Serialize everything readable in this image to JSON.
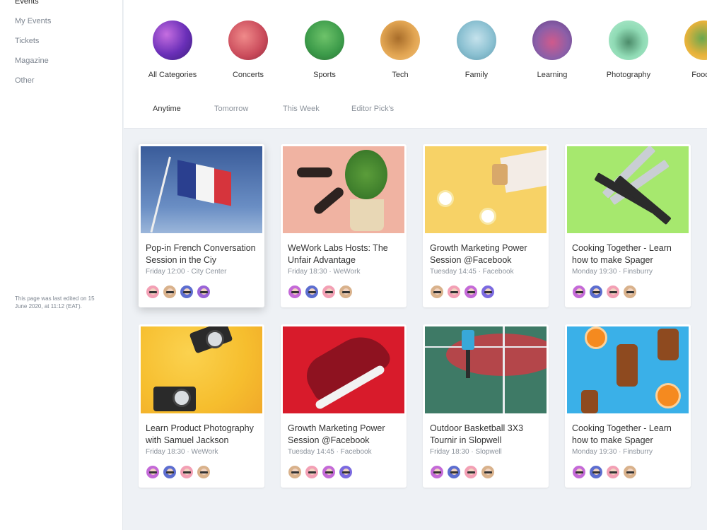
{
  "sidebar": {
    "items": [
      {
        "label": "Events"
      },
      {
        "label": "My Events"
      },
      {
        "label": "Tickets"
      },
      {
        "label": "Magazine"
      },
      {
        "label": "Other"
      }
    ],
    "edit_note": "This page was last edited on 15 June 2020, at 11:12 (EAT)."
  },
  "categories": [
    {
      "label": "All Categories",
      "color": "#7b3fc4"
    },
    {
      "label": "Concerts",
      "color": "#d9596b"
    },
    {
      "label": "Sports",
      "color": "#3f9b4d"
    },
    {
      "label": "Tech",
      "color": "#e2a552"
    },
    {
      "label": "Family",
      "color": "#8cc1d2"
    },
    {
      "label": "Learning",
      "color": "#8b5fa8"
    },
    {
      "label": "Photography",
      "color": "#90dbb5"
    },
    {
      "label": "Food &",
      "color": "#e8b23a"
    }
  ],
  "tabs": [
    {
      "label": "Anytime",
      "active": true
    },
    {
      "label": "Tomorrow"
    },
    {
      "label": "This Week"
    },
    {
      "label": "Editor Pick's"
    }
  ],
  "events": [
    {
      "title": "Pop-in French Conversation Session in the Ciy",
      "meta": "Friday 12:00 · City Center",
      "image": "flag"
    },
    {
      "title": "WeWork Labs Hosts: The Unfair Advantage",
      "meta": "Friday 18:30 · WeWork",
      "image": "sunglasses"
    },
    {
      "title": "Growth Marketing Power Session @Facebook",
      "meta": "Tuesday 14:45 · Facebook",
      "image": "flowers"
    },
    {
      "title": "Cooking Together - Learn how to make Spager",
      "meta": "Monday 19:30 · Finsburry",
      "image": "knives"
    },
    {
      "title": "Learn Product Photography with Samuel Jackson",
      "meta": "Friday 18:30 · WeWork",
      "image": "cameras"
    },
    {
      "title": "Growth Marketing Power Session @Facebook",
      "meta": "Tuesday 14:45 · Facebook",
      "image": "sneaker"
    },
    {
      "title": "Outdoor Basketball 3X3 Tournir in Slopwell",
      "meta": "Friday 18:30 · Slopwell",
      "image": "basketball"
    },
    {
      "title": "Cooking Together - Learn how to make Spager",
      "meta": "Monday 19:30 · Finsburry",
      "image": "juice"
    }
  ],
  "colors": {
    "sidebar_bg": "#ffffff",
    "page_bg": "#eef1f5",
    "text_primary": "#333333",
    "text_muted": "#8b929b"
  }
}
